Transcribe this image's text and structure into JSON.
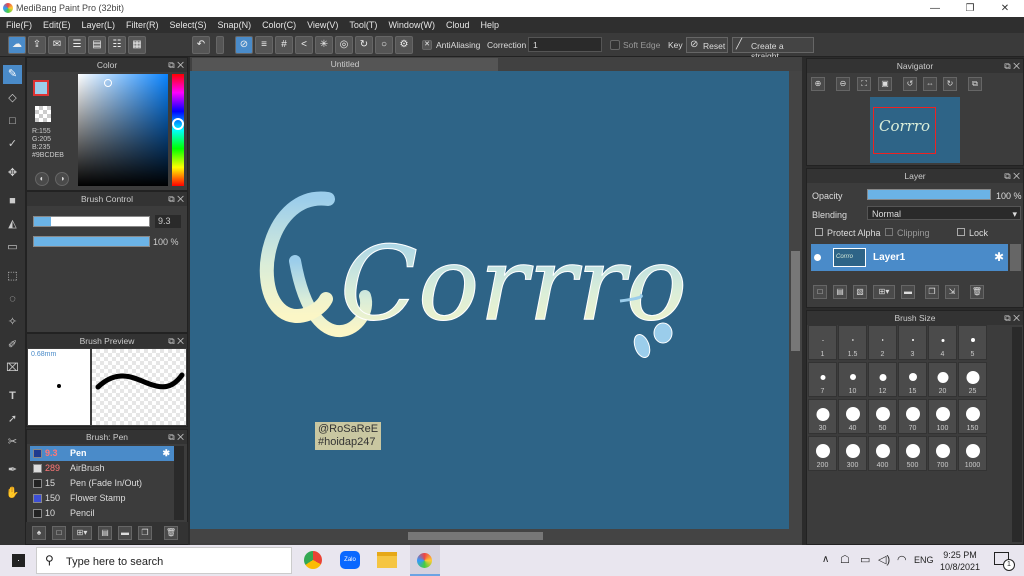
{
  "window": {
    "title": "MediBang Paint Pro (32bit)"
  },
  "menu": [
    "File(F)",
    "Edit(E)",
    "Layer(L)",
    "Filter(R)",
    "Select(S)",
    "Snap(N)",
    "Color(C)",
    "View(V)",
    "Tool(T)",
    "Window(W)",
    "Cloud",
    "Help"
  ],
  "toolbar": {
    "antialiasing": "AntiAliasing",
    "correction_label": "Correction",
    "correction_value": "1",
    "soft_edge": "Soft Edge",
    "key": "Key",
    "reset": "Reset",
    "straight": "Create a straight"
  },
  "color_panel": {
    "title": "Color",
    "r": "R:155",
    "g": "G:205",
    "b": "B:235",
    "hex": "#9BCDEB",
    "fg_color": "#9BCDEB"
  },
  "brush_control": {
    "title": "Brush Control",
    "size": "9.3",
    "opacity": "100 %",
    "size_fraction": 0.15,
    "opacity_fraction": 1.0
  },
  "brush_preview": {
    "title": "Brush Preview",
    "size_label": "0.68mm"
  },
  "brush_list": {
    "title": "Brush: Pen",
    "items": [
      {
        "size": "9.3",
        "name": "Pen",
        "color": "#1f3b8f"
      },
      {
        "size": "289",
        "name": "AirBrush",
        "color": "#dddddd"
      },
      {
        "size": "15",
        "name": "Pen (Fade In/Out)",
        "color": "#222222"
      },
      {
        "size": "150",
        "name": "Flower Stamp",
        "color": "#3d4fd6"
      },
      {
        "size": "10",
        "name": "Pencil",
        "color": "#222222"
      }
    ]
  },
  "document": {
    "tab": "Untitled",
    "canvas_text": "Corrro",
    "watermark_line1": "@RoSaReE",
    "watermark_line2": "#hoidap247",
    "bg": "#2e6487"
  },
  "navigator": {
    "title": "Navigator"
  },
  "layer_panel": {
    "title": "Layer",
    "opacity_label": "Opacity",
    "opacity_value": "100 %",
    "blending_label": "Blending",
    "blending_value": "Normal",
    "protect_alpha": "Protect Alpha",
    "clipping": "Clipping",
    "lock": "Lock",
    "layer_name": "Layer1",
    "thumb_text": "Corrro"
  },
  "brush_size": {
    "title": "Brush Size",
    "sizes": [
      "1",
      "1.5",
      "2",
      "3",
      "4",
      "5",
      "7",
      "10",
      "12",
      "15",
      "20",
      "25",
      "30",
      "40",
      "50",
      "70",
      "100",
      "150",
      "200",
      "300",
      "400",
      "500",
      "700",
      "1000"
    ]
  },
  "taskbar": {
    "search_placeholder": "Type here to search",
    "time": "9:25 PM",
    "date": "10/8/2021",
    "lang": "ENG",
    "notif_count": "1",
    "zalo": "Zalo"
  }
}
